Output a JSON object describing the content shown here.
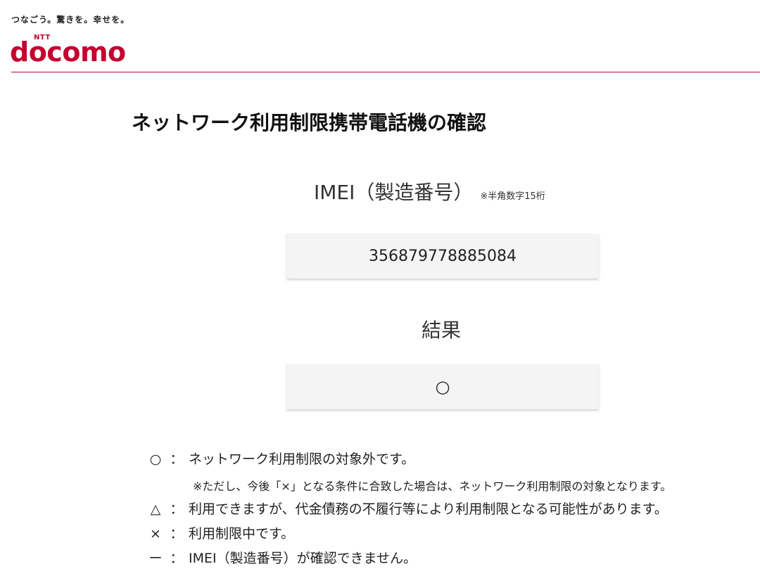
{
  "header": {
    "tagline": "つなごう。驚きを。幸せを。",
    "logo_ntt": "NTT",
    "logo_text": "docomo",
    "brand_color": "#c3002f"
  },
  "main": {
    "title": "ネットワーク利用制限携帯電話機の確認",
    "imei_label": "IMEI（製造番号）",
    "imei_note": "※半角数字15桁",
    "imei_value": "356879778885084",
    "result_label": "結果",
    "result_value": "○"
  },
  "legend": {
    "items": [
      {
        "symbol": "○",
        "colon": "：",
        "text": "ネットワーク利用制限の対象外です。"
      },
      {
        "note": "※ただし、今後「×」となる条件に合致した場合は、ネットワーク利用制限の対象となります。"
      },
      {
        "symbol": "△",
        "colon": "：",
        "text": "利用できますが、代金債務の不履行等により利用制限となる可能性があります。"
      },
      {
        "symbol": "×",
        "colon": "：",
        "text": "利用制限中です。"
      },
      {
        "symbol": "ー",
        "colon": "：",
        "text": "IMEI（製造番号）が確認できません。"
      }
    ]
  }
}
